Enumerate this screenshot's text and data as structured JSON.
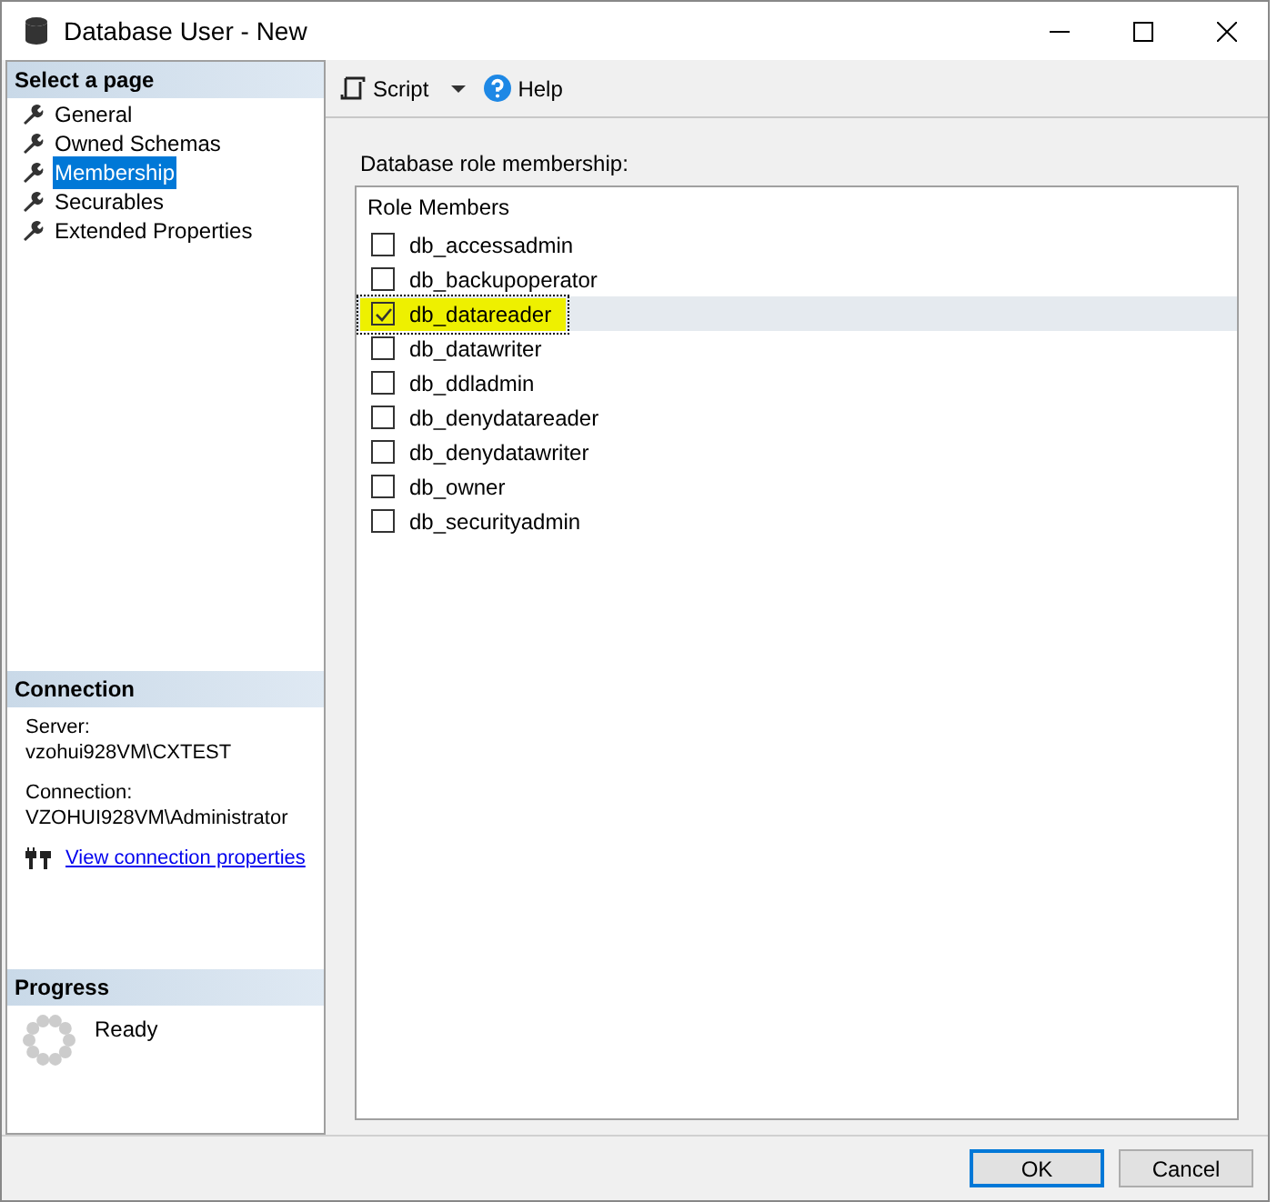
{
  "window": {
    "title": "Database User - New"
  },
  "sidebar": {
    "heading": "Select a page",
    "items": [
      {
        "label": "General",
        "selected": false
      },
      {
        "label": "Owned Schemas",
        "selected": false
      },
      {
        "label": "Membership",
        "selected": true
      },
      {
        "label": "Securables",
        "selected": false
      },
      {
        "label": "Extended Properties",
        "selected": false
      }
    ]
  },
  "connection": {
    "heading": "Connection",
    "server_label": "Server:",
    "server": "vzohui928VM\\CXTEST",
    "connection_label": "Connection:",
    "connection": "VZOHUI928VM\\Administrator",
    "link": "View connection properties"
  },
  "progress": {
    "heading": "Progress",
    "status": "Ready"
  },
  "toolbar": {
    "script": "Script",
    "help": "Help"
  },
  "roles": {
    "label": "Database role membership:",
    "column": "Role Members",
    "items": [
      {
        "name": "db_accessadmin",
        "checked": false,
        "selected": false,
        "highlighted": false
      },
      {
        "name": "db_backupoperator",
        "checked": false,
        "selected": false,
        "highlighted": false
      },
      {
        "name": "db_datareader",
        "checked": true,
        "selected": true,
        "highlighted": true
      },
      {
        "name": "db_datawriter",
        "checked": false,
        "selected": false,
        "highlighted": false
      },
      {
        "name": "db_ddladmin",
        "checked": false,
        "selected": false,
        "highlighted": false
      },
      {
        "name": "db_denydatareader",
        "checked": false,
        "selected": false,
        "highlighted": false
      },
      {
        "name": "db_denydatawriter",
        "checked": false,
        "selected": false,
        "highlighted": false
      },
      {
        "name": "db_owner",
        "checked": false,
        "selected": false,
        "highlighted": false
      },
      {
        "name": "db_securityadmin",
        "checked": false,
        "selected": false,
        "highlighted": false
      }
    ]
  },
  "buttons": [
    {
      "label": "OK",
      "default": true
    },
    {
      "label": "Cancel",
      "default": false
    }
  ]
}
